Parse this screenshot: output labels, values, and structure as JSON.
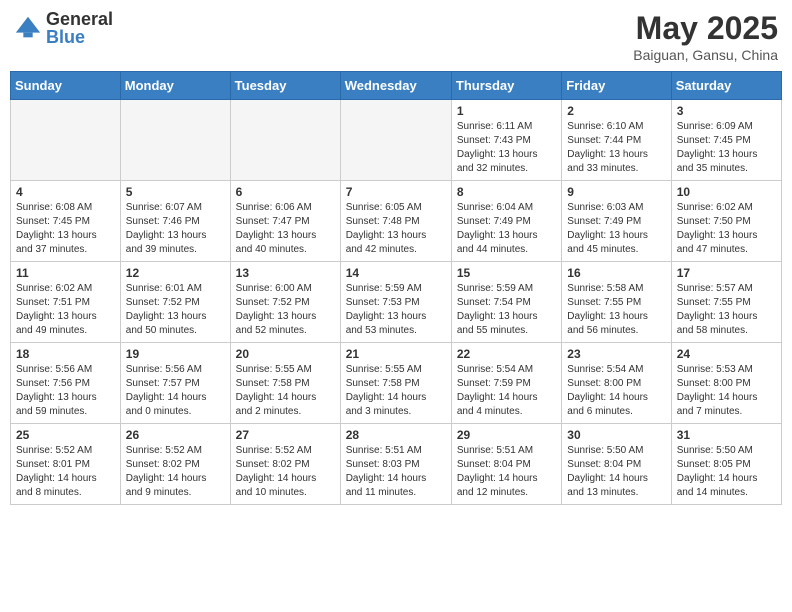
{
  "logo": {
    "general": "General",
    "blue": "Blue"
  },
  "title": {
    "month_year": "May 2025",
    "location": "Baiguan, Gansu, China"
  },
  "days_of_week": [
    "Sunday",
    "Monday",
    "Tuesday",
    "Wednesday",
    "Thursday",
    "Friday",
    "Saturday"
  ],
  "weeks": [
    [
      {
        "day": "",
        "content": ""
      },
      {
        "day": "",
        "content": ""
      },
      {
        "day": "",
        "content": ""
      },
      {
        "day": "",
        "content": ""
      },
      {
        "day": "1",
        "content": "Sunrise: 6:11 AM\nSunset: 7:43 PM\nDaylight: 13 hours\nand 32 minutes."
      },
      {
        "day": "2",
        "content": "Sunrise: 6:10 AM\nSunset: 7:44 PM\nDaylight: 13 hours\nand 33 minutes."
      },
      {
        "day": "3",
        "content": "Sunrise: 6:09 AM\nSunset: 7:45 PM\nDaylight: 13 hours\nand 35 minutes."
      }
    ],
    [
      {
        "day": "4",
        "content": "Sunrise: 6:08 AM\nSunset: 7:45 PM\nDaylight: 13 hours\nand 37 minutes."
      },
      {
        "day": "5",
        "content": "Sunrise: 6:07 AM\nSunset: 7:46 PM\nDaylight: 13 hours\nand 39 minutes."
      },
      {
        "day": "6",
        "content": "Sunrise: 6:06 AM\nSunset: 7:47 PM\nDaylight: 13 hours\nand 40 minutes."
      },
      {
        "day": "7",
        "content": "Sunrise: 6:05 AM\nSunset: 7:48 PM\nDaylight: 13 hours\nand 42 minutes."
      },
      {
        "day": "8",
        "content": "Sunrise: 6:04 AM\nSunset: 7:49 PM\nDaylight: 13 hours\nand 44 minutes."
      },
      {
        "day": "9",
        "content": "Sunrise: 6:03 AM\nSunset: 7:49 PM\nDaylight: 13 hours\nand 45 minutes."
      },
      {
        "day": "10",
        "content": "Sunrise: 6:02 AM\nSunset: 7:50 PM\nDaylight: 13 hours\nand 47 minutes."
      }
    ],
    [
      {
        "day": "11",
        "content": "Sunrise: 6:02 AM\nSunset: 7:51 PM\nDaylight: 13 hours\nand 49 minutes."
      },
      {
        "day": "12",
        "content": "Sunrise: 6:01 AM\nSunset: 7:52 PM\nDaylight: 13 hours\nand 50 minutes."
      },
      {
        "day": "13",
        "content": "Sunrise: 6:00 AM\nSunset: 7:52 PM\nDaylight: 13 hours\nand 52 minutes."
      },
      {
        "day": "14",
        "content": "Sunrise: 5:59 AM\nSunset: 7:53 PM\nDaylight: 13 hours\nand 53 minutes."
      },
      {
        "day": "15",
        "content": "Sunrise: 5:59 AM\nSunset: 7:54 PM\nDaylight: 13 hours\nand 55 minutes."
      },
      {
        "day": "16",
        "content": "Sunrise: 5:58 AM\nSunset: 7:55 PM\nDaylight: 13 hours\nand 56 minutes."
      },
      {
        "day": "17",
        "content": "Sunrise: 5:57 AM\nSunset: 7:55 PM\nDaylight: 13 hours\nand 58 minutes."
      }
    ],
    [
      {
        "day": "18",
        "content": "Sunrise: 5:56 AM\nSunset: 7:56 PM\nDaylight: 13 hours\nand 59 minutes."
      },
      {
        "day": "19",
        "content": "Sunrise: 5:56 AM\nSunset: 7:57 PM\nDaylight: 14 hours\nand 0 minutes."
      },
      {
        "day": "20",
        "content": "Sunrise: 5:55 AM\nSunset: 7:58 PM\nDaylight: 14 hours\nand 2 minutes."
      },
      {
        "day": "21",
        "content": "Sunrise: 5:55 AM\nSunset: 7:58 PM\nDaylight: 14 hours\nand 3 minutes."
      },
      {
        "day": "22",
        "content": "Sunrise: 5:54 AM\nSunset: 7:59 PM\nDaylight: 14 hours\nand 4 minutes."
      },
      {
        "day": "23",
        "content": "Sunrise: 5:54 AM\nSunset: 8:00 PM\nDaylight: 14 hours\nand 6 minutes."
      },
      {
        "day": "24",
        "content": "Sunrise: 5:53 AM\nSunset: 8:00 PM\nDaylight: 14 hours\nand 7 minutes."
      }
    ],
    [
      {
        "day": "25",
        "content": "Sunrise: 5:52 AM\nSunset: 8:01 PM\nDaylight: 14 hours\nand 8 minutes."
      },
      {
        "day": "26",
        "content": "Sunrise: 5:52 AM\nSunset: 8:02 PM\nDaylight: 14 hours\nand 9 minutes."
      },
      {
        "day": "27",
        "content": "Sunrise: 5:52 AM\nSunset: 8:02 PM\nDaylight: 14 hours\nand 10 minutes."
      },
      {
        "day": "28",
        "content": "Sunrise: 5:51 AM\nSunset: 8:03 PM\nDaylight: 14 hours\nand 11 minutes."
      },
      {
        "day": "29",
        "content": "Sunrise: 5:51 AM\nSunset: 8:04 PM\nDaylight: 14 hours\nand 12 minutes."
      },
      {
        "day": "30",
        "content": "Sunrise: 5:50 AM\nSunset: 8:04 PM\nDaylight: 14 hours\nand 13 minutes."
      },
      {
        "day": "31",
        "content": "Sunrise: 5:50 AM\nSunset: 8:05 PM\nDaylight: 14 hours\nand 14 minutes."
      }
    ]
  ]
}
